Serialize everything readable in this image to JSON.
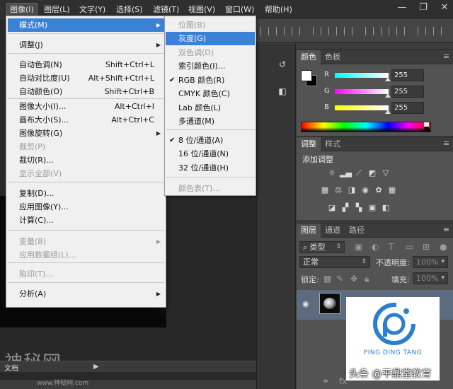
{
  "menubar": {
    "items": [
      "图像(I)",
      "图层(L)",
      "文字(Y)",
      "选择(S)",
      "滤镜(T)",
      "视图(V)",
      "窗口(W)",
      "帮助(H)"
    ],
    "active_index": 0
  },
  "window_controls": {
    "minimize": "—",
    "restore": "❐",
    "close": "✕"
  },
  "image_menu": {
    "items": [
      {
        "label": "模式(M)",
        "shortcut": "",
        "submenu": true,
        "disabled": false,
        "highlighted": true
      },
      {
        "label": "调整(J)",
        "shortcut": "",
        "submenu": true,
        "disabled": false
      },
      {
        "label": "自动色调(N)",
        "shortcut": "Shift+Ctrl+L",
        "disabled": false
      },
      {
        "label": "自动对比度(U)",
        "shortcut": "Alt+Shift+Ctrl+L",
        "disabled": false
      },
      {
        "label": "自动颜色(O)",
        "shortcut": "Shift+Ctrl+B",
        "disabled": false
      },
      {
        "label": "图像大小(I)...",
        "shortcut": "Alt+Ctrl+I",
        "disabled": false
      },
      {
        "label": "画布大小(S)...",
        "shortcut": "Alt+Ctrl+C",
        "disabled": false
      },
      {
        "label": "图像旋转(G)",
        "shortcut": "",
        "submenu": true,
        "disabled": false
      },
      {
        "label": "裁剪(P)",
        "shortcut": "",
        "disabled": true
      },
      {
        "label": "裁切(R)...",
        "shortcut": "",
        "disabled": false
      },
      {
        "label": "显示全部(V)",
        "shortcut": "",
        "disabled": true
      },
      {
        "label": "复制(D)...",
        "shortcut": "",
        "disabled": false
      },
      {
        "label": "应用图像(Y)...",
        "shortcut": "",
        "disabled": false
      },
      {
        "label": "计算(C)...",
        "shortcut": "",
        "disabled": false
      },
      {
        "label": "变量(B)",
        "shortcut": "",
        "submenu": true,
        "disabled": true
      },
      {
        "label": "应用数据组(L)...",
        "shortcut": "",
        "disabled": true
      },
      {
        "label": "陷印(T)...",
        "shortcut": "",
        "disabled": true
      },
      {
        "label": "分析(A)",
        "shortcut": "",
        "submenu": true,
        "disabled": false
      }
    ]
  },
  "mode_menu": {
    "items": [
      {
        "label": "位图(B)",
        "disabled": true,
        "checked": false
      },
      {
        "label": "灰度(G)",
        "disabled": false,
        "checked": false,
        "highlighted": true
      },
      {
        "label": "双色调(D)",
        "disabled": true,
        "checked": false
      },
      {
        "label": "索引颜色(I)...",
        "disabled": false,
        "checked": false
      },
      {
        "label": "RGB 颜色(R)",
        "disabled": false,
        "checked": true
      },
      {
        "label": "CMYK 颜色(C)",
        "disabled": false,
        "checked": false
      },
      {
        "label": "Lab 颜色(L)",
        "disabled": false,
        "checked": false
      },
      {
        "label": "多通道(M)",
        "disabled": false,
        "checked": false
      },
      {
        "label": "8 位/通道(A)",
        "disabled": false,
        "checked": true
      },
      {
        "label": "16 位/通道(N)",
        "disabled": false,
        "checked": false
      },
      {
        "label": "32 位/通道(H)",
        "disabled": false,
        "checked": false
      },
      {
        "label": "颜色表(T)...",
        "disabled": true,
        "checked": false
      }
    ]
  },
  "color_panel": {
    "tabs": [
      "颜色",
      "色板"
    ],
    "channels": [
      {
        "label": "R",
        "value": "255",
        "gradient": "linear-gradient(to right,#00ffff,#ffffff)"
      },
      {
        "label": "G",
        "value": "255",
        "gradient": "linear-gradient(to right,#ff00ff,#ffffff)"
      },
      {
        "label": "B",
        "value": "255",
        "gradient": "linear-gradient(to right,#ffff00,#ffffff)"
      }
    ]
  },
  "adjustments_panel": {
    "tabs": [
      "调整",
      "样式"
    ],
    "title": "添加调整"
  },
  "layers_panel": {
    "tabs": [
      "图层",
      "通道",
      "路径"
    ],
    "filter_label": "类型",
    "blend_mode": "正常",
    "opacity_label": "不透明度:",
    "opacity_value": "100%",
    "lock_label": "锁定:",
    "fill_label": "填充:",
    "fill_value": "100%",
    "layer_name": "背景"
  },
  "status": {
    "doc_label": "文档"
  },
  "watermark": {
    "main": "神秘网",
    "sub": "www.神秘网.com"
  },
  "logo": {
    "text": "PING DING TANG",
    "color": "#2a7fd3"
  },
  "caption": "头条 @平鼎堂教育"
}
